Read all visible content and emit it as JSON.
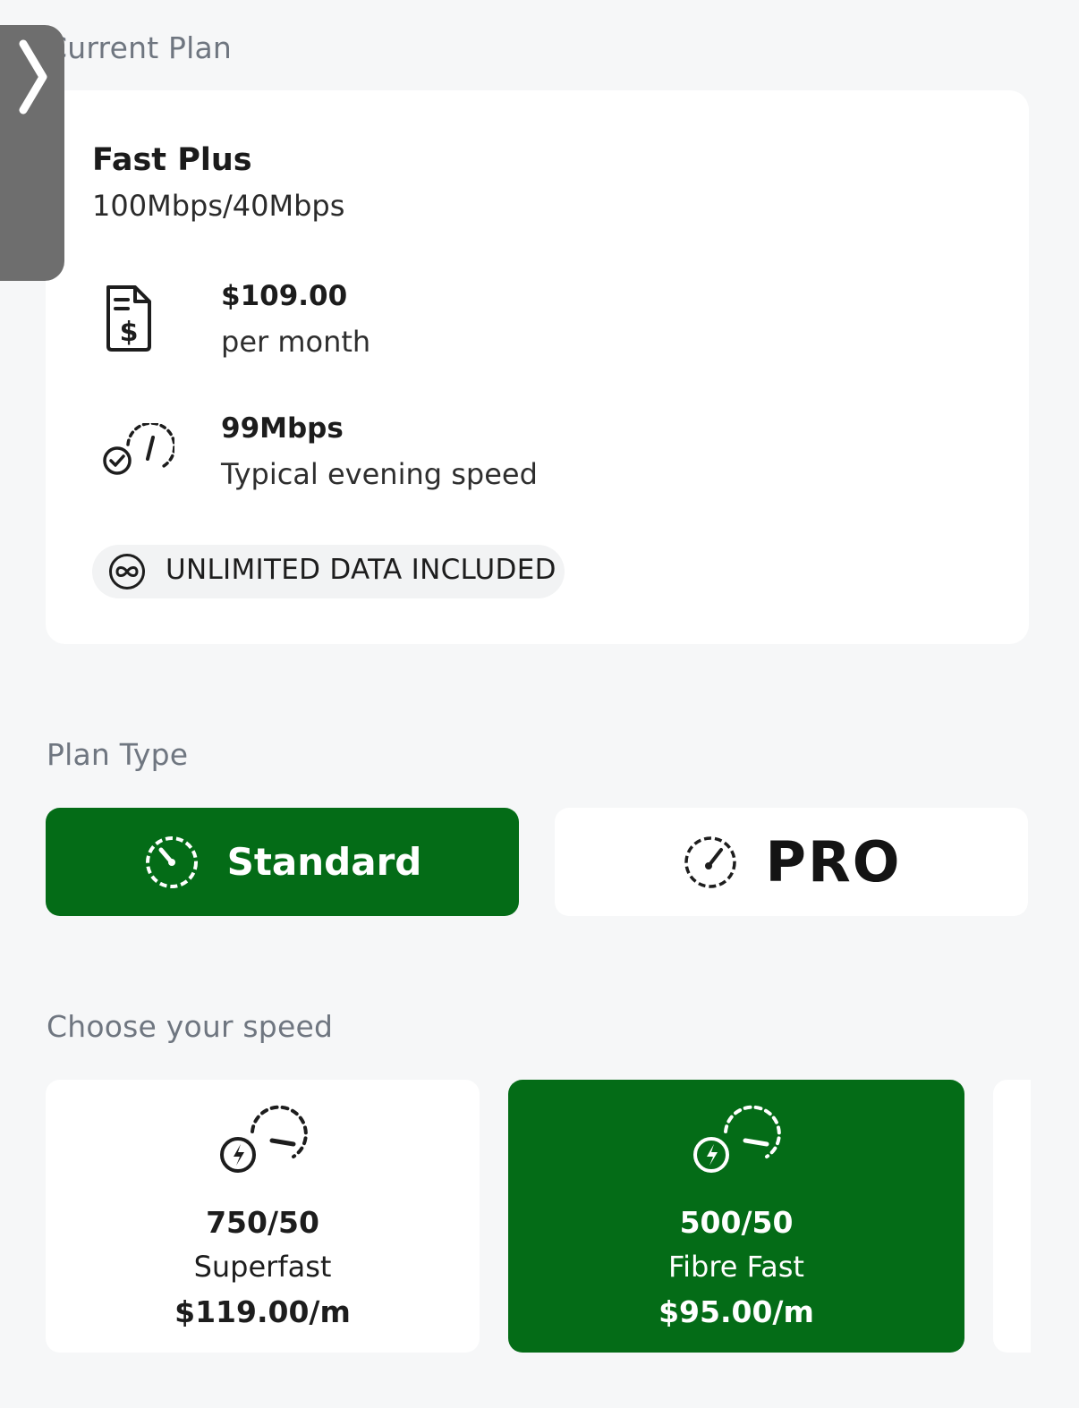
{
  "current_plan": {
    "section_label": "Current Plan",
    "name": "Fast Plus",
    "rate": "100Mbps/40Mbps",
    "price": "$109.00",
    "price_period": "per month",
    "evening_speed": "99Mbps",
    "evening_speed_label": "Typical evening speed",
    "data_badge": "UNLIMITED DATA INCLUDED"
  },
  "plan_type": {
    "section_label": "Plan Type",
    "options": [
      {
        "label": "Standard",
        "selected": true
      },
      {
        "label": "PRO",
        "selected": false
      }
    ]
  },
  "speed": {
    "section_label": "Choose your speed",
    "options": [
      {
        "value": "750/50",
        "name": "Superfast",
        "price": "$119.00/m",
        "selected": false
      },
      {
        "value": "500/50",
        "name": "Fibre Fast",
        "price": "$95.00/m",
        "selected": true
      }
    ]
  },
  "side_tab": {
    "icon": "chevron-right-icon"
  },
  "colors": {
    "accent": "#046c17",
    "background": "#f6f7f8",
    "card": "#ffffff"
  }
}
